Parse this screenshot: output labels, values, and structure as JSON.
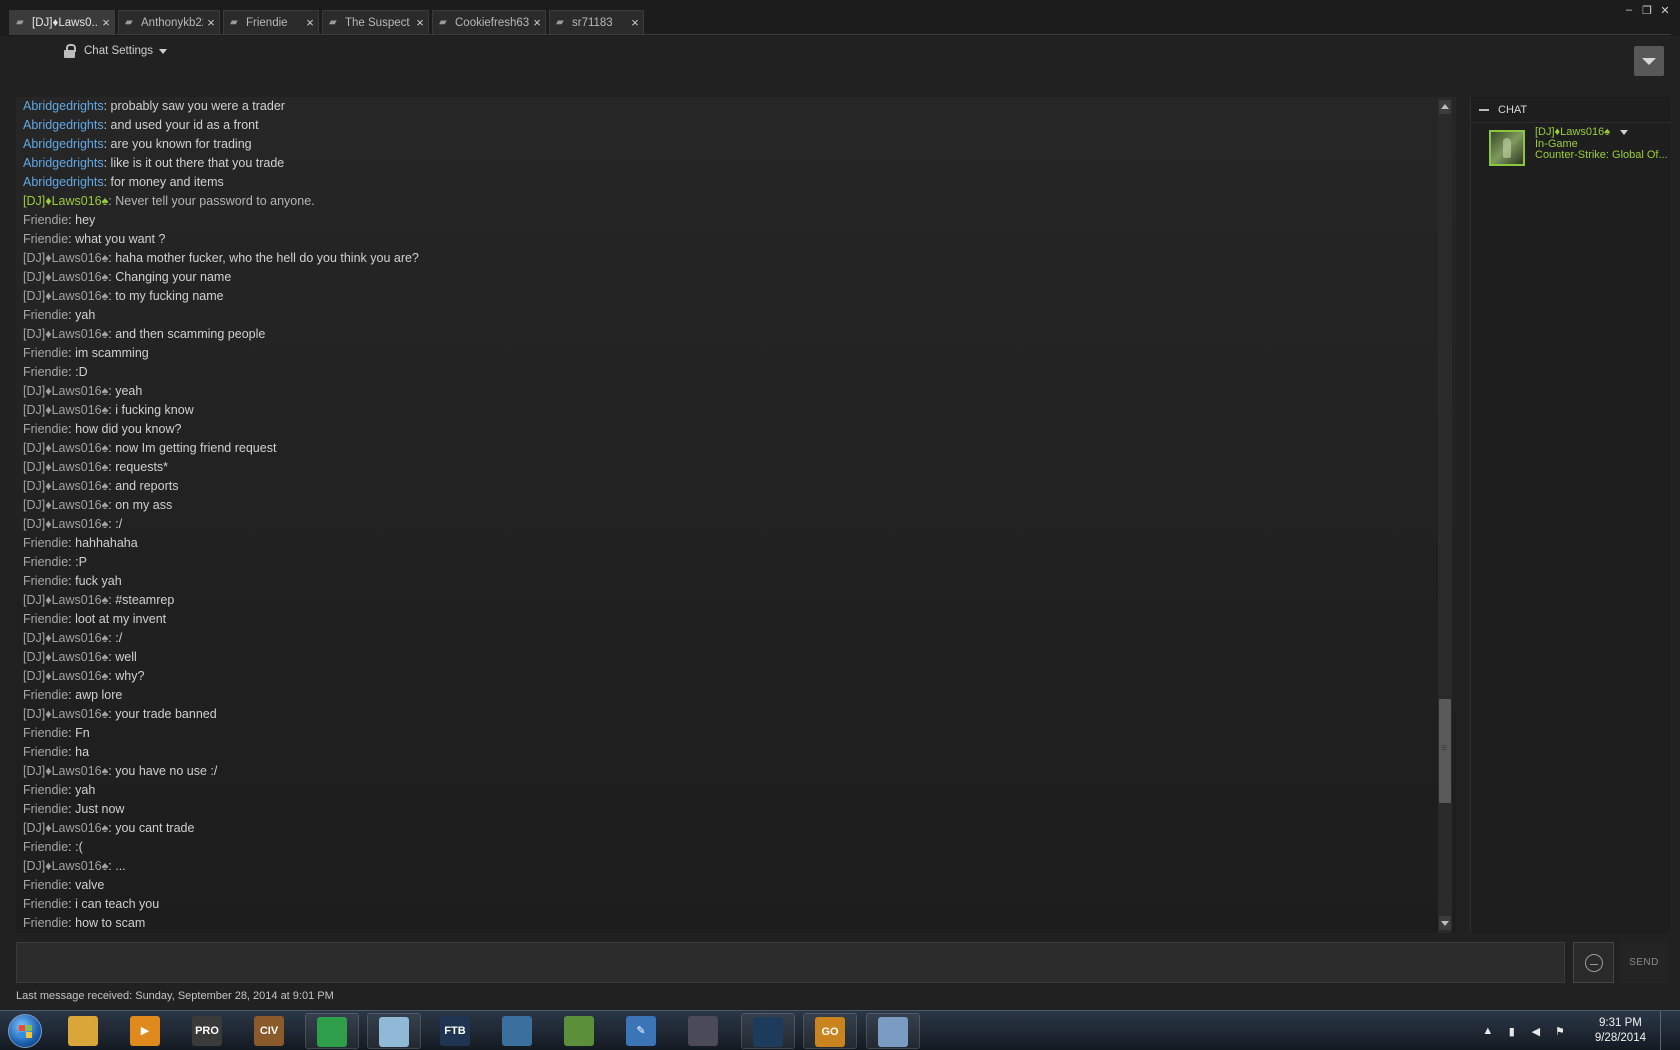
{
  "tabs": [
    {
      "label": "[DJ]♦Laws0...",
      "active": true
    },
    {
      "label": "Anthonykb22"
    },
    {
      "label": "Friendie"
    },
    {
      "label": "The Suspect"
    },
    {
      "label": "Cookiefresh63"
    },
    {
      "label": "sr71183"
    }
  ],
  "window_controls": {
    "minimize": "‒",
    "restore": "❐",
    "close": "✕"
  },
  "chat_settings": {
    "label": "Chat Settings"
  },
  "messages": [
    {
      "sender": "Abridgedrights",
      "text": ": probably saw you were a trader"
    },
    {
      "sender": "Abridgedrights",
      "text": ": and used your id as a front"
    },
    {
      "sender": "Abridgedrights",
      "text": ": are you known for trading"
    },
    {
      "sender": "Abridgedrights",
      "text": ": like is it out there that you trade"
    },
    {
      "sender": "Abridgedrights",
      "text": ": for money and items"
    },
    {
      "sender": "[DJ]♦Laws016♠",
      "text": ": Never tell your password to anyone.",
      "style": "green"
    },
    {
      "sender": "Friendie",
      "text": ": hey"
    },
    {
      "sender": "Friendie",
      "text": ": what you want ?"
    },
    {
      "sender": "[DJ]♦Laws016♠",
      "text": ": haha mother fucker, who the hell do you think you are?"
    },
    {
      "sender": "[DJ]♦Laws016♠",
      "text": ": Changing your name"
    },
    {
      "sender": "[DJ]♦Laws016♠",
      "text": ": to my fucking name"
    },
    {
      "sender": "Friendie",
      "text": ": yah"
    },
    {
      "sender": "[DJ]♦Laws016♠",
      "text": ": and then scamming people"
    },
    {
      "sender": "Friendie",
      "text": ": im scamming"
    },
    {
      "sender": "Friendie",
      "text": ": :D"
    },
    {
      "sender": "[DJ]♦Laws016♠",
      "text": ": yeah"
    },
    {
      "sender": "[DJ]♦Laws016♠",
      "text": ": i fucking know"
    },
    {
      "sender": "Friendie",
      "text": ": how did you know?"
    },
    {
      "sender": "[DJ]♦Laws016♠",
      "text": ": now Im getting friend request"
    },
    {
      "sender": "[DJ]♦Laws016♠",
      "text": ": requests*"
    },
    {
      "sender": "[DJ]♦Laws016♠",
      "text": ": and reports"
    },
    {
      "sender": "[DJ]♦Laws016♠",
      "text": ": on my ass"
    },
    {
      "sender": "[DJ]♦Laws016♠",
      "text": ": :/"
    },
    {
      "sender": "Friendie",
      "text": ": hahhahaha"
    },
    {
      "sender": "Friendie",
      "text": ": :P"
    },
    {
      "sender": "Friendie",
      "text": ": fuck yah"
    },
    {
      "sender": "[DJ]♦Laws016♠",
      "text": ": #steamrep"
    },
    {
      "sender": "Friendie",
      "text": ": loot at my invent"
    },
    {
      "sender": "[DJ]♦Laws016♠",
      "text": ": :/"
    },
    {
      "sender": "[DJ]♦Laws016♠",
      "text": ": well"
    },
    {
      "sender": "[DJ]♦Laws016♠",
      "text": ": why?"
    },
    {
      "sender": "Friendie",
      "text": ": awp lore"
    },
    {
      "sender": "[DJ]♦Laws016♠",
      "text": ": your trade banned"
    },
    {
      "sender": "Friendie",
      "text": ": Fn"
    },
    {
      "sender": "Friendie",
      "text": ": ha"
    },
    {
      "sender": "[DJ]♦Laws016♠",
      "text": ": you have no use :/"
    },
    {
      "sender": "Friendie",
      "text": ": yah"
    },
    {
      "sender": "Friendie",
      "text": ": Just now"
    },
    {
      "sender": "[DJ]♦Laws016♠",
      "text": ": you cant trade"
    },
    {
      "sender": "Friendie",
      "text": ": :("
    },
    {
      "sender": "[DJ]♦Laws016♠",
      "text": ": ..."
    },
    {
      "sender": "Friendie",
      "text": ": valve"
    },
    {
      "sender": "Friendie",
      "text": ": i can teach you"
    },
    {
      "sender": "Friendie",
      "text": ": how to scam"
    }
  ],
  "friends_panel": {
    "header": "CHAT",
    "friend": {
      "name": "[DJ]♦Laws016♠",
      "status": "In-Game",
      "game": "Counter-Strike: Global Of..."
    }
  },
  "input": {
    "send_label": "SEND"
  },
  "last_message": "Last message received: Sunday, September 28, 2014 at 9:01 PM",
  "taskbar": {
    "apps": [
      {
        "name": "explorer-icon",
        "glyph": "",
        "color": "#d9a63a"
      },
      {
        "name": "media-player-icon",
        "glyph": "▶",
        "color": "#e08a1e"
      },
      {
        "name": "app-pro-icon",
        "glyph": "PRO",
        "color": "#3a3a3a"
      },
      {
        "name": "civ-icon",
        "glyph": "CIV",
        "color": "#8a5a2a"
      },
      {
        "name": "chrome-icon",
        "glyph": "",
        "color": "#2f9e4a"
      },
      {
        "name": "notes-icon",
        "glyph": "",
        "color": "#8fb9d6"
      },
      {
        "name": "ftb-icon",
        "glyph": "FTB",
        "color": "#1e3450"
      },
      {
        "name": "hive-icon",
        "glyph": "",
        "color": "#3a6f9e"
      },
      {
        "name": "minecraft-icon",
        "glyph": "",
        "color": "#5b8f3a"
      },
      {
        "name": "editor-icon",
        "glyph": "✎",
        "color": "#3c74b8"
      },
      {
        "name": "video-editor-icon",
        "glyph": "",
        "color": "#4a4a58"
      },
      {
        "name": "steam-icon",
        "glyph": "",
        "color": "#1d3b5a"
      },
      {
        "name": "csgo-icon",
        "glyph": "GO",
        "color": "#c9841e"
      },
      {
        "name": "calculator-icon",
        "glyph": "",
        "color": "#7b9cc2"
      }
    ],
    "clock_time": "9:31 PM",
    "clock_date": "9/28/2014"
  },
  "colors": {
    "abridge_sender": "#62a7e3",
    "dj_green": "#9acd3b",
    "text": "#d0d0d0"
  }
}
